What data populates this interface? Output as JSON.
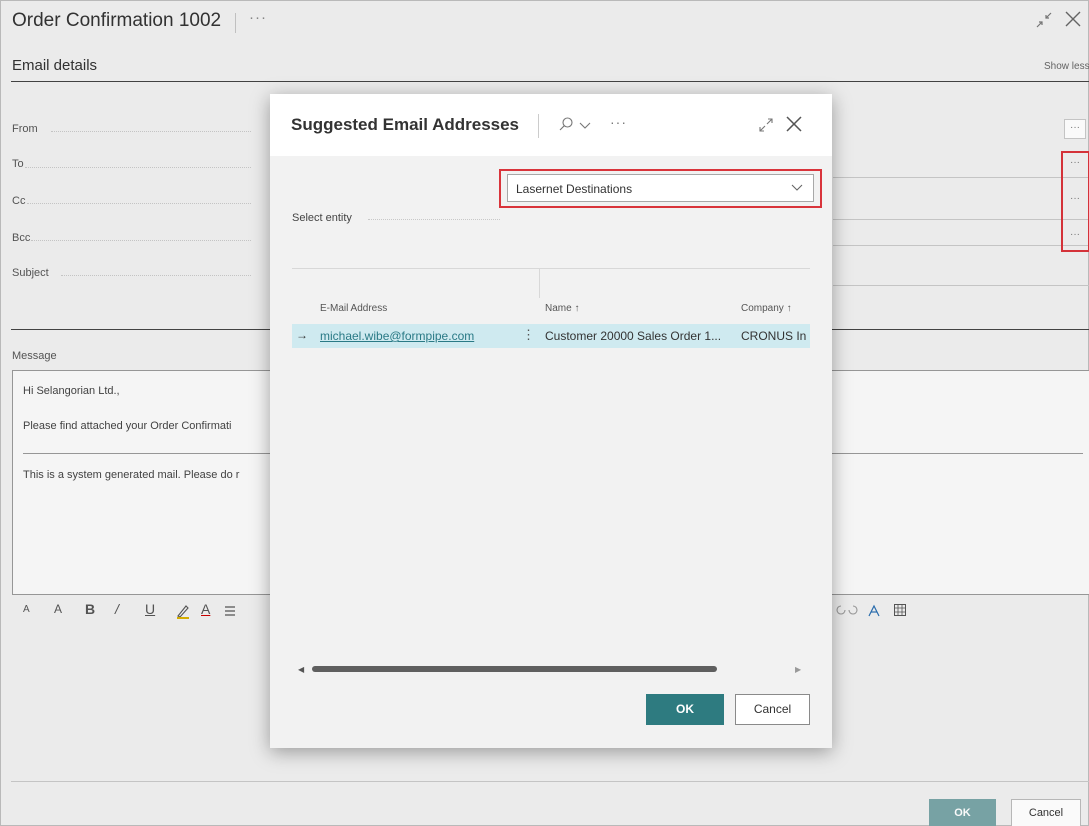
{
  "page": {
    "title": "Order Confirmation 1002",
    "more": "···",
    "section_title": "Email details",
    "show_less": "Show less",
    "fields": {
      "from": "From",
      "to": "To",
      "cc": "Cc",
      "bcc": "Bcc",
      "subject": "Subject"
    },
    "field_button_label": "···",
    "message_label": "Message",
    "message_lines": [
      "Hi Selangorian Ltd.,",
      "Please find attached your Order Confirmati",
      "This is a system generated mail. Please do r"
    ],
    "format_toolbar": [
      "A",
      "A",
      "B",
      "/",
      "U",
      "A"
    ],
    "ok_label": "OK",
    "cancel_label": "Cancel"
  },
  "dialog": {
    "title": "Suggested Email Addresses",
    "more": "···",
    "select_label": "Select entity",
    "select_value": "Lasernet Destinations",
    "columns": [
      "E-Mail Address",
      "Name ↑",
      "Company ↑"
    ],
    "rows": [
      {
        "arrow": "→",
        "email": "michael.wibe@formpipe.com",
        "kebab": "⋮",
        "name": "Customer 20000 Sales Order 1...",
        "company": "CRONUS In"
      }
    ],
    "ok_label": "OK",
    "cancel_label": "Cancel"
  },
  "colors": {
    "accent": "#2e7b80",
    "highlight": "#d9343b",
    "row_selected": "#cfeaf0",
    "link": "#2a7a86"
  }
}
